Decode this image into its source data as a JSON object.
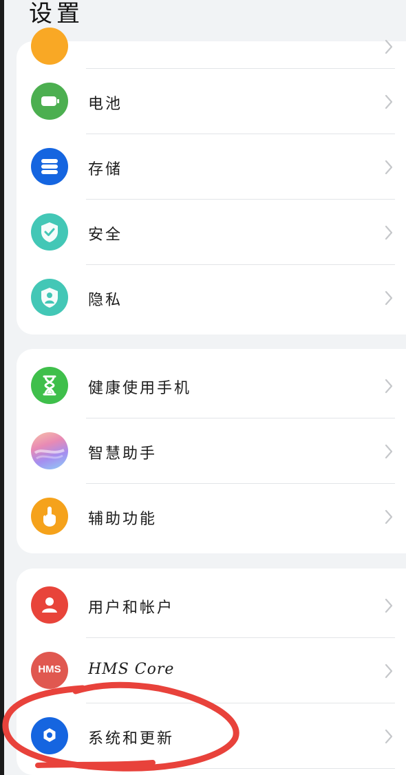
{
  "header": {
    "title": "设置"
  },
  "groups": [
    {
      "items": [
        {
          "label": "",
          "icon": "partial-orange-icon",
          "color": "#f9a825"
        },
        {
          "label": "电池",
          "icon": "battery-icon",
          "color": "#4caf50"
        },
        {
          "label": "存储",
          "icon": "storage-icon",
          "color": "#1565e0"
        },
        {
          "label": "安全",
          "icon": "shield-check-icon",
          "color": "#43c7b6"
        },
        {
          "label": "隐私",
          "icon": "privacy-shield-icon",
          "color": "#43c7b6"
        }
      ]
    },
    {
      "items": [
        {
          "label": "健康使用手机",
          "icon": "hourglass-icon",
          "color": "#3fbf4b"
        },
        {
          "label": "智慧助手",
          "icon": "celia-orb-icon",
          "color": "#c9a6f0"
        },
        {
          "label": "辅助功能",
          "icon": "hand-tap-icon",
          "color": "#f5a21b"
        }
      ]
    },
    {
      "items": [
        {
          "label": "用户和帐户",
          "icon": "user-icon",
          "color": "#e8443a"
        },
        {
          "label": "HMS Core",
          "icon": "hms-icon",
          "color": "#e05850",
          "icon_text": "HMS"
        },
        {
          "label": "系统和更新",
          "icon": "gear-icon",
          "color": "#1565e0"
        }
      ]
    }
  ],
  "annotation": {
    "color": "#e8423b"
  }
}
